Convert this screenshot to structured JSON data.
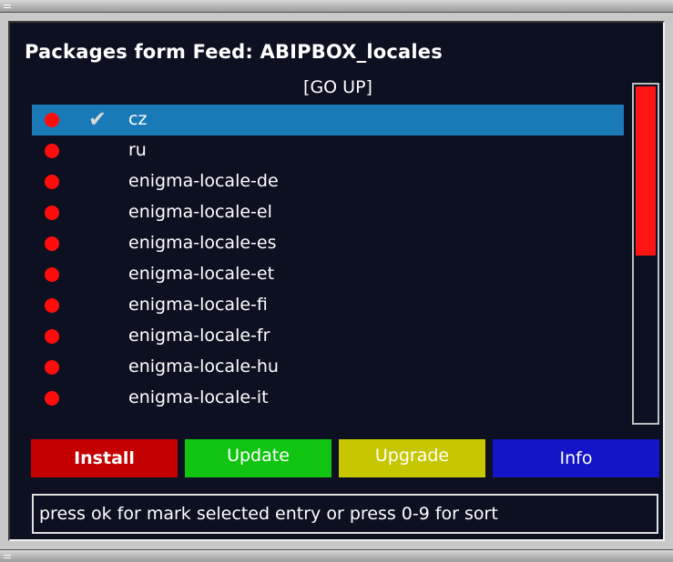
{
  "window": {
    "title": "Packages form Feed: ABIPBOX_locales",
    "go_up": "[GO UP]"
  },
  "packages": [
    {
      "name": "cz",
      "status_color": "#ff0d0d",
      "checked": true,
      "selected": true
    },
    {
      "name": "ru",
      "status_color": "#ff0d0d",
      "checked": false,
      "selected": false
    },
    {
      "name": "enigma-locale-de",
      "status_color": "#ff0d0d",
      "checked": false,
      "selected": false
    },
    {
      "name": "enigma-locale-el",
      "status_color": "#ff0d0d",
      "checked": false,
      "selected": false
    },
    {
      "name": "enigma-locale-es",
      "status_color": "#ff0d0d",
      "checked": false,
      "selected": false
    },
    {
      "name": "enigma-locale-et",
      "status_color": "#ff0d0d",
      "checked": false,
      "selected": false
    },
    {
      "name": "enigma-locale-fi",
      "status_color": "#ff0d0d",
      "checked": false,
      "selected": false
    },
    {
      "name": "enigma-locale-fr",
      "status_color": "#ff0d0d",
      "checked": false,
      "selected": false
    },
    {
      "name": "enigma-locale-hu",
      "status_color": "#ff0d0d",
      "checked": false,
      "selected": false
    },
    {
      "name": "enigma-locale-it",
      "status_color": "#ff0d0d",
      "checked": false,
      "selected": false
    }
  ],
  "scrollbar": {
    "position_fraction": 0.5
  },
  "buttons": {
    "install": "Install",
    "update": "Update",
    "upgrade": "Upgrade",
    "info": "Info"
  },
  "colors": {
    "install": "#c40000",
    "update": "#11c411",
    "upgrade": "#c7c700",
    "info": "#1414c8",
    "selection": "#1a7ab8"
  },
  "icons": {
    "status": "red-dot-icon",
    "check": "checkmark-icon"
  },
  "hint": "press ok for mark selected entry or press 0-9 for sort"
}
